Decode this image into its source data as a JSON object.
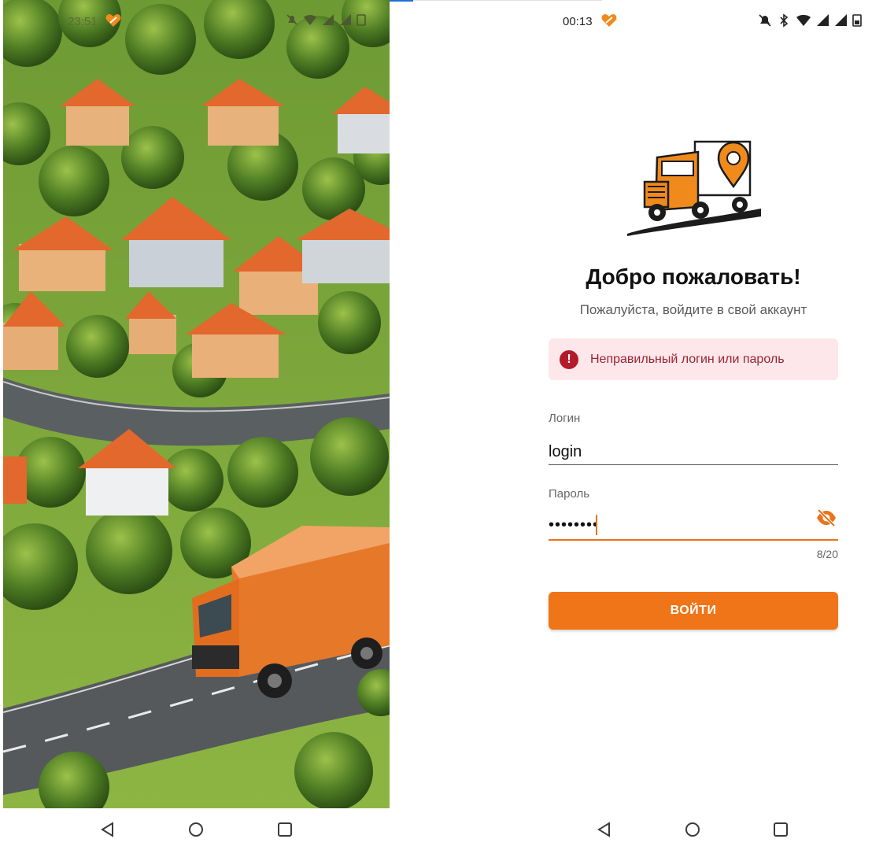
{
  "left_screen": {
    "status_time": "23:51",
    "background_image": "aerial-suburb-with-orange-truck-illustration"
  },
  "right_screen": {
    "status_time": "00:13",
    "status_icons": [
      "bell-off-icon",
      "bluetooth-icon",
      "wifi-icon",
      "signal-icon",
      "signal-icon",
      "battery-icon"
    ],
    "welcome_title": "Добро пожаловать!",
    "welcome_subtitle": "Пожалуйста, войдите в свой аккаунт",
    "error_message": "Неправильный логин или пароль",
    "login_field": {
      "label": "Логин",
      "value": "login"
    },
    "password_field": {
      "label": "Пароль",
      "value": "••••••••",
      "counter": "8/20"
    },
    "submit_label": "ВОЙТИ"
  },
  "colors": {
    "accent": "#ef7518",
    "error_bg": "#fde7ea",
    "error_text": "#9a2330"
  },
  "navigation": [
    "back-icon",
    "home-icon",
    "recents-icon"
  ]
}
